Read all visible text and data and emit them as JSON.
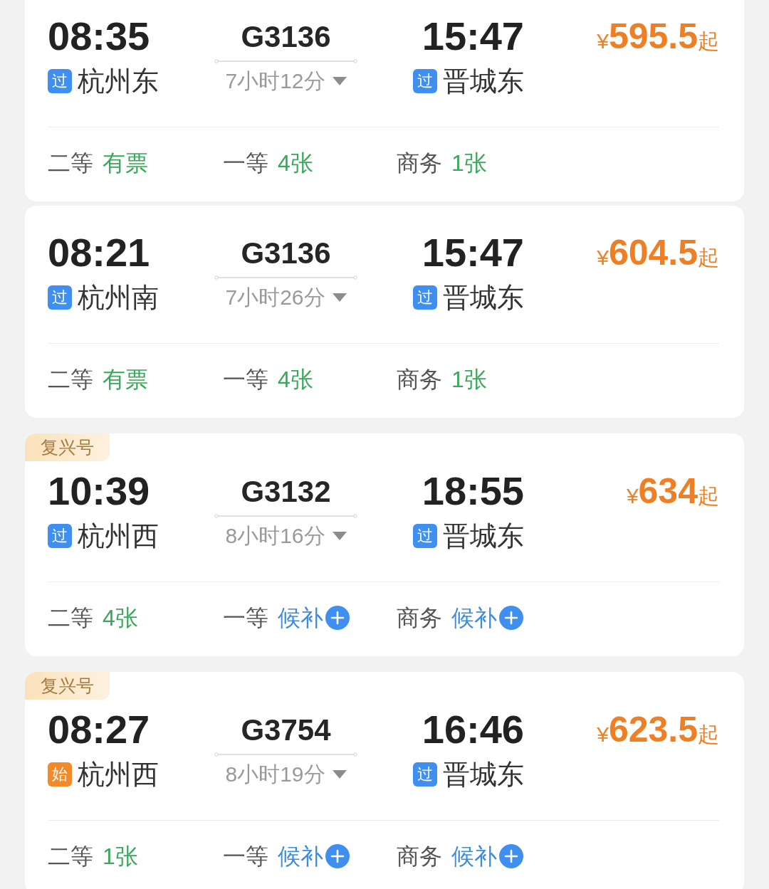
{
  "trains": [
    {
      "departure": {
        "time": "08:35",
        "badge": {
          "text": "过",
          "color": "#3f8ff0"
        },
        "station": "杭州东"
      },
      "train_number": "G3136",
      "duration": "7小时12分",
      "arrival": {
        "time": "15:47",
        "badge": {
          "text": "过",
          "color": "#3f8ff0"
        },
        "station": "晋城东"
      },
      "price": {
        "currency": "¥",
        "amount": "595.5",
        "suffix": "起"
      },
      "seats": [
        {
          "class": "二等",
          "kind": "ticket",
          "availability": "有票"
        },
        {
          "class": "一等",
          "kind": "ticket",
          "availability": "4张"
        },
        {
          "class": "商务",
          "kind": "ticket",
          "availability": "1张"
        }
      ]
    },
    {
      "departure": {
        "time": "08:21",
        "badge": {
          "text": "过",
          "color": "#3f8ff0"
        },
        "station": "杭州南"
      },
      "train_number": "G3136",
      "duration": "7小时26分",
      "arrival": {
        "time": "15:47",
        "badge": {
          "text": "过",
          "color": "#3f8ff0"
        },
        "station": "晋城东"
      },
      "price": {
        "currency": "¥",
        "amount": "604.5",
        "suffix": "起"
      },
      "seats": [
        {
          "class": "二等",
          "kind": "ticket",
          "availability": "有票"
        },
        {
          "class": "一等",
          "kind": "ticket",
          "availability": "4张"
        },
        {
          "class": "商务",
          "kind": "ticket",
          "availability": "1张"
        }
      ]
    },
    {
      "tag": "复兴号",
      "departure": {
        "time": "10:39",
        "badge": {
          "text": "过",
          "color": "#3f8ff0"
        },
        "station": "杭州西"
      },
      "train_number": "G3132",
      "duration": "8小时16分",
      "arrival": {
        "time": "18:55",
        "badge": {
          "text": "过",
          "color": "#3f8ff0"
        },
        "station": "晋城东"
      },
      "price": {
        "currency": "¥",
        "amount": "634",
        "suffix": "起"
      },
      "seats": [
        {
          "class": "二等",
          "kind": "ticket",
          "availability": "4张"
        },
        {
          "class": "一等",
          "kind": "waitlist",
          "availability": "候补"
        },
        {
          "class": "商务",
          "kind": "waitlist",
          "availability": "候补"
        }
      ]
    },
    {
      "tag": "复兴号",
      "departure": {
        "time": "08:27",
        "badge": {
          "text": "始",
          "color": "#f28a2a"
        },
        "station": "杭州西"
      },
      "train_number": "G3754",
      "duration": "8小时19分",
      "arrival": {
        "time": "16:46",
        "badge": {
          "text": "过",
          "color": "#3f8ff0"
        },
        "station": "晋城东"
      },
      "price": {
        "currency": "¥",
        "amount": "623.5",
        "suffix": "起"
      },
      "seats": [
        {
          "class": "二等",
          "kind": "ticket",
          "availability": "1张"
        },
        {
          "class": "一等",
          "kind": "waitlist",
          "availability": "候补"
        },
        {
          "class": "商务",
          "kind": "waitlist",
          "availability": "候补"
        }
      ]
    }
  ]
}
